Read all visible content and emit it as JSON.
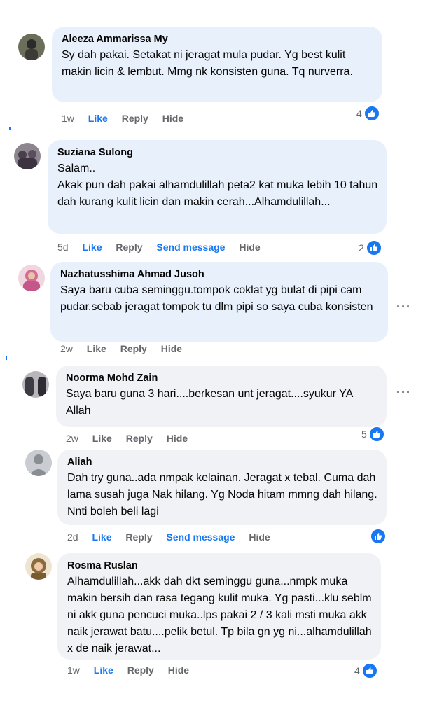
{
  "comments": [
    {
      "name": "Aleeza Ammarissa My",
      "text": "Sy dah pakai. Setakat ni jeragat mula pudar. Yg best kulit makin licin & lembut. Mmg nk konsisten guna. Tq nurverra.",
      "time": "1w",
      "like": "Like",
      "reply": "Reply",
      "hide": "Hide",
      "reactions": "4",
      "bubble": "blue",
      "avatar_color": "#6b6f5a"
    },
    {
      "name": "Suziana Sulong",
      "text": "Salam..\nAkak pun dah pakai alhamdulillah peta2 kat muka lebih 10 tahun dah kurang kulit licin dan makin cerah...Alhamdulillah...",
      "time": "5d",
      "like": "Like",
      "reply": "Reply",
      "send": "Send message",
      "hide": "Hide",
      "reactions": "2",
      "bubble": "blue",
      "avatar_color": "#5a4d5e"
    },
    {
      "name": "Nazhatusshima Ahmad Jusoh",
      "text": "Saya baru cuba seminggu.tompok coklat yg bulat di pipi cam pudar.sebab jeragat tompok tu dlm pipi so saya cuba konsisten",
      "time": "2w",
      "like": "Like",
      "reply": "Reply",
      "hide": "Hide",
      "more": "···",
      "bubble": "blue",
      "avatar_color": "#d56b98"
    },
    {
      "name": "Noorma Mohd Zain",
      "text": "Saya baru guna 3 hari....berkesan unt jeragat....syukur YA Allah",
      "time": "2w",
      "like": "Like",
      "reply": "Reply",
      "hide": "Hide",
      "reactions": "5",
      "more": "···",
      "bubble": "grey",
      "avatar_color": "#3d3c44"
    },
    {
      "name": "Aliah",
      "text": "Dah try guna..ada nmpak kelainan. Jeragat x tebal. Cuma dah lama susah juga Nak hilang. Yg Noda hitam mmng dah hilang. Nnti boleh beli lagi",
      "time": "2d",
      "like": "Like",
      "reply": "Reply",
      "send": "Send message",
      "hide": "Hide",
      "bubble": "grey",
      "avatar_color": "#c9ccd1"
    },
    {
      "name": "Rosma Ruslan",
      "text": "Alhamdulillah...akk dah dkt seminggu guna...nmpk muka makin bersih dan rasa tegang kulit muka. Yg pasti...klu seblm ni akk guna pencuci muka..lps pakai 2 / 3 kali msti muka akk naik jerawat batu....pelik betul. Tp bila gn yg ni...alhamdulillah x de naik jerawat...",
      "time": "1w",
      "like": "Like",
      "reply": "Reply",
      "hide": "Hide",
      "reactions": "4",
      "bubble": "grey",
      "avatar_color": "#8a6b3f"
    }
  ]
}
